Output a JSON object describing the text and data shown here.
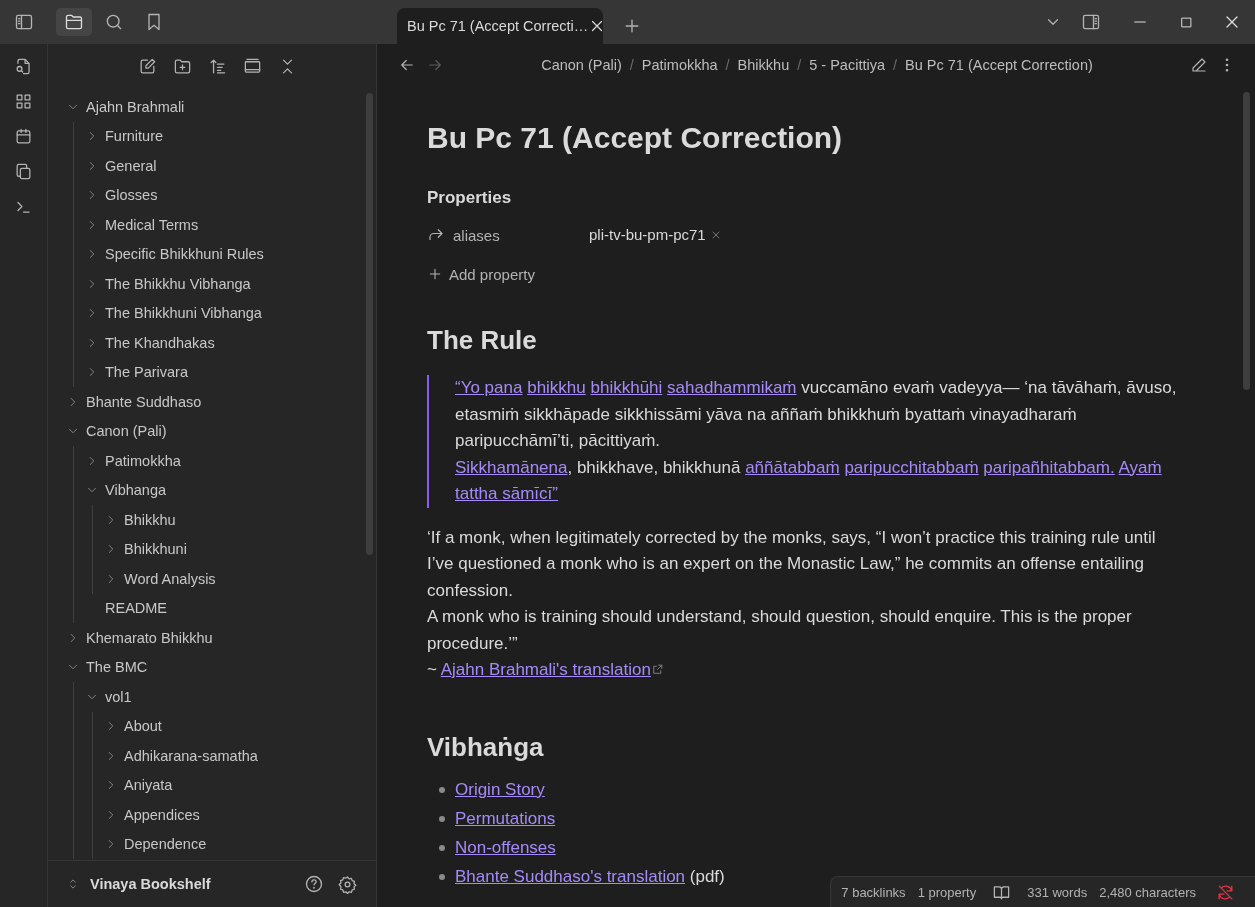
{
  "sidebar_tabs": [
    {
      "kind": "files",
      "selected": true
    },
    {
      "kind": "search",
      "selected": false
    },
    {
      "kind": "bookmarks",
      "selected": false
    }
  ],
  "tabs": [
    {
      "title": "Bu Pc 71 (Accept Correcti…",
      "selected": true
    }
  ],
  "file_tree": [
    {
      "kind": "folder",
      "name": "Ajahn Brahmali",
      "expanded": true,
      "children": [
        {
          "kind": "folder",
          "name": "Furniture",
          "expanded": false
        },
        {
          "kind": "folder",
          "name": "General",
          "expanded": false
        },
        {
          "kind": "folder",
          "name": "Glosses",
          "expanded": false
        },
        {
          "kind": "folder",
          "name": "Medical Terms",
          "expanded": false
        },
        {
          "kind": "folder",
          "name": "Specific Bhikkhuni Rules",
          "expanded": false
        },
        {
          "kind": "folder",
          "name": "The Bhikkhu Vibhanga",
          "expanded": false
        },
        {
          "kind": "folder",
          "name": "The Bhikkhuni Vibhanga",
          "expanded": false
        },
        {
          "kind": "folder",
          "name": "The Khandhakas",
          "expanded": false
        },
        {
          "kind": "folder",
          "name": "The Parivara",
          "expanded": false
        }
      ]
    },
    {
      "kind": "folder",
      "name": "Bhante Suddhaso",
      "expanded": false
    },
    {
      "kind": "folder",
      "name": "Canon (Pali)",
      "expanded": true,
      "children": [
        {
          "kind": "folder",
          "name": "Patimokkha",
          "expanded": false
        },
        {
          "kind": "folder",
          "name": "Vibhanga",
          "expanded": true,
          "children": [
            {
              "kind": "folder",
              "name": "Bhikkhu",
              "expanded": false
            },
            {
              "kind": "folder",
              "name": "Bhikkhuni",
              "expanded": false
            },
            {
              "kind": "folder",
              "name": "Word Analysis",
              "expanded": false
            }
          ]
        },
        {
          "kind": "file",
          "name": "README"
        }
      ]
    },
    {
      "kind": "folder",
      "name": "Khemarato Bhikkhu",
      "expanded": false
    },
    {
      "kind": "folder",
      "name": "The BMC",
      "expanded": true,
      "children": [
        {
          "kind": "folder",
          "name": "vol1",
          "expanded": true,
          "children": [
            {
              "kind": "folder",
              "name": "About",
              "expanded": false
            },
            {
              "kind": "folder",
              "name": "Adhikarana-samatha",
              "expanded": false
            },
            {
              "kind": "folder",
              "name": "Aniyata",
              "expanded": false
            },
            {
              "kind": "folder",
              "name": "Appendices",
              "expanded": false
            },
            {
              "kind": "folder",
              "name": "Dependence",
              "expanded": false
            }
          ]
        }
      ]
    }
  ],
  "vault": {
    "name": "Vinaya Bookshelf"
  },
  "history": {
    "back_disabled": false,
    "forward_disabled": true
  },
  "breadcrumbs": [
    {
      "kind": "crumb",
      "text": "Canon (Pali)"
    },
    {
      "kind": "separator",
      "text": "/"
    },
    {
      "kind": "crumb",
      "text": "Patimokkha"
    },
    {
      "kind": "separator",
      "text": "/"
    },
    {
      "kind": "crumb",
      "text": "Bhikkhu"
    },
    {
      "kind": "separator",
      "text": "/"
    },
    {
      "kind": "crumb",
      "text": "5 - Pacittiya"
    },
    {
      "kind": "separator",
      "text": "/"
    },
    {
      "kind": "crumb",
      "text": "Bu Pc 71 (Accept Correction)"
    }
  ],
  "note": {
    "title": "Bu Pc 71 (Accept Correction)",
    "properties": {
      "heading": "Properties",
      "items": [
        {
          "key": "aliases",
          "values": [
            "pli-tv-bu-pm-pc71"
          ]
        }
      ],
      "add_label": "Add property"
    },
    "blocks": [
      {
        "kind": "heading",
        "text": "The Rule"
      },
      {
        "kind": "quote",
        "lines": [
          [
            {
              "kind": "link",
              "text": "“Yo pana"
            },
            {
              "kind": "link",
              "text": "bhikkhu"
            },
            {
              "kind": "link",
              "text": "bhikkhūhi"
            },
            {
              "kind": "link",
              "text": "sahadhammikaṁ"
            },
            {
              "kind": "text",
              "text": " vuccamāno evaṁ vadeyya— ‘na tāvāhaṁ, āvuso, etasmiṁ sikkhāpade sikkhissāmi yāva na aññaṁ bhikkhuṁ byattaṁ vinayadharaṁ paripucchāmī’ti, pācittiyaṁ."
            }
          ],
          [
            {
              "kind": "link",
              "text": "Sikkhamānena"
            },
            {
              "kind": "text",
              "text": ", bhikkhave, bhikkhunā "
            },
            {
              "kind": "link",
              "text": "aññātabbaṁ"
            },
            {
              "kind": "link",
              "text": "paripucchitabbaṁ"
            },
            {
              "kind": "link",
              "text": "paripañhitabbaṁ."
            },
            {
              "kind": "link",
              "text": "Ayaṁ"
            },
            {
              "kind": "link",
              "text": "tattha sāmīcī”"
            }
          ]
        ]
      },
      {
        "kind": "paragraph",
        "lines": [
          [
            {
              "kind": "text",
              "text": "‘If a monk, when legitimately corrected by the monks, says, “I won’t practice this training rule until I’ve questioned a monk who is an expert on the Monastic Law,” he commits an offense entailing confession."
            }
          ],
          [
            {
              "kind": "text",
              "text": "A monk who is training should understand, should question, should enquire. This is the proper procedure.’”"
            }
          ],
          [
            {
              "kind": "text",
              "text": "~ "
            },
            {
              "kind": "link",
              "text": "Ajahn Brahmali's translation",
              "external": true
            }
          ]
        ]
      },
      {
        "kind": "heading",
        "text": "Vibhaṅga"
      },
      {
        "kind": "list",
        "items": [
          [
            {
              "kind": "link",
              "text": "Origin Story"
            }
          ],
          [
            {
              "kind": "link",
              "text": "Permutations"
            }
          ],
          [
            {
              "kind": "link",
              "text": "Non-offenses"
            }
          ],
          [
            {
              "kind": "link",
              "text": "Bhante Suddhaso's translation"
            },
            {
              "kind": "text",
              "text": " (pdf)"
            }
          ]
        ]
      }
    ]
  },
  "status_bar": {
    "items": [
      "7 backlinks",
      "1 property"
    ],
    "counts": [
      "331 words",
      "2,480 characters"
    ],
    "sync_error": true
  }
}
